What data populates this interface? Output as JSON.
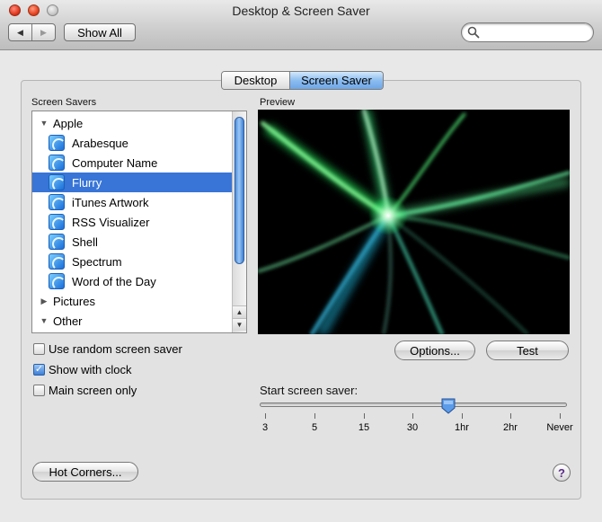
{
  "window": {
    "title": "Desktop & Screen Saver"
  },
  "toolbar": {
    "back_icon": "back-arrow-icon",
    "forward_icon": "forward-arrow-icon",
    "back_glyph": "◀",
    "forward_glyph": "▶",
    "show_all_label": "Show All",
    "search_placeholder": ""
  },
  "tabs": [
    {
      "label": "Desktop",
      "selected": false
    },
    {
      "label": "Screen Saver",
      "selected": true
    }
  ],
  "screen_savers": {
    "heading": "Screen Savers",
    "items": [
      {
        "label": "Apple",
        "type": "group",
        "expanded": true,
        "glyph": "▼"
      },
      {
        "label": "Arabesque",
        "type": "item"
      },
      {
        "label": "Computer Name",
        "type": "item"
      },
      {
        "label": "Flurry",
        "type": "item",
        "selected": true
      },
      {
        "label": "iTunes Artwork",
        "type": "item"
      },
      {
        "label": "RSS Visualizer",
        "type": "item"
      },
      {
        "label": "Shell",
        "type": "item"
      },
      {
        "label": "Spectrum",
        "type": "item"
      },
      {
        "label": "Word of the Day",
        "type": "item"
      },
      {
        "label": "Pictures",
        "type": "group",
        "expanded": false,
        "glyph": "▶"
      },
      {
        "label": "Other",
        "type": "group",
        "expanded": true,
        "glyph": "▼"
      }
    ],
    "scroll_up_glyph": "▲",
    "scroll_down_glyph": "▼"
  },
  "preview": {
    "heading": "Preview",
    "options_label": "Options...",
    "test_label": "Test"
  },
  "options": {
    "random_label": "Use random screen saver",
    "random_checked": false,
    "clock_label": "Show with clock",
    "clock_checked": true,
    "clock_check_glyph": "✓",
    "main_screen_label": "Main screen only",
    "main_screen_checked": false
  },
  "start": {
    "label": "Start screen saver:",
    "ticks": [
      "3",
      "5",
      "15",
      "30",
      "1hr",
      "2hr",
      "Never"
    ],
    "value": "1hr"
  },
  "footer": {
    "hot_corners_label": "Hot Corners...",
    "help_label": "?"
  },
  "colors": {
    "selection": "#3875d7",
    "tab_selected": "#8cbdf0"
  }
}
